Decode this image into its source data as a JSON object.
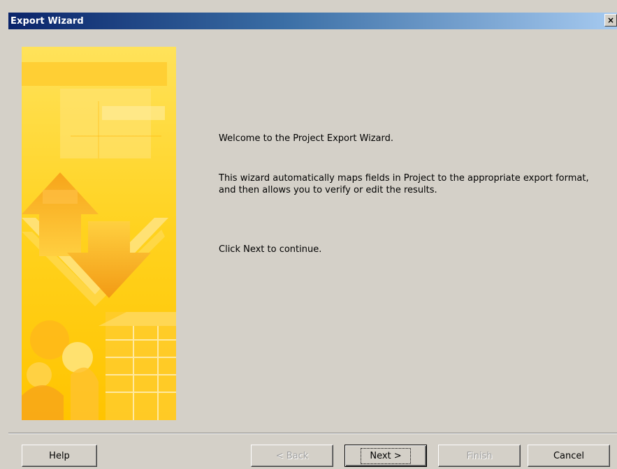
{
  "window": {
    "title": "Export Wizard",
    "close_label": "×"
  },
  "content": {
    "welcome": "Welcome to the Project Export Wizard.",
    "description": "This wizard automatically maps fields in Project to the appropriate export format, and then allows you to verify or edit the results.",
    "click_next": "Click Next to continue."
  },
  "buttons": {
    "help": "Help",
    "back": "< Back",
    "next": "Next >",
    "finish": "Finish",
    "cancel": "Cancel"
  },
  "colors": {
    "title_bar_start": "#0a246a",
    "title_bar_end": "#a6caf0",
    "dialog_face": "#d4d0c8",
    "banner_yellow": "#ffd21e",
    "banner_orange": "#f7a41a"
  },
  "icons": {
    "close": "close-icon",
    "banner": "wizard-banner-graphic"
  }
}
